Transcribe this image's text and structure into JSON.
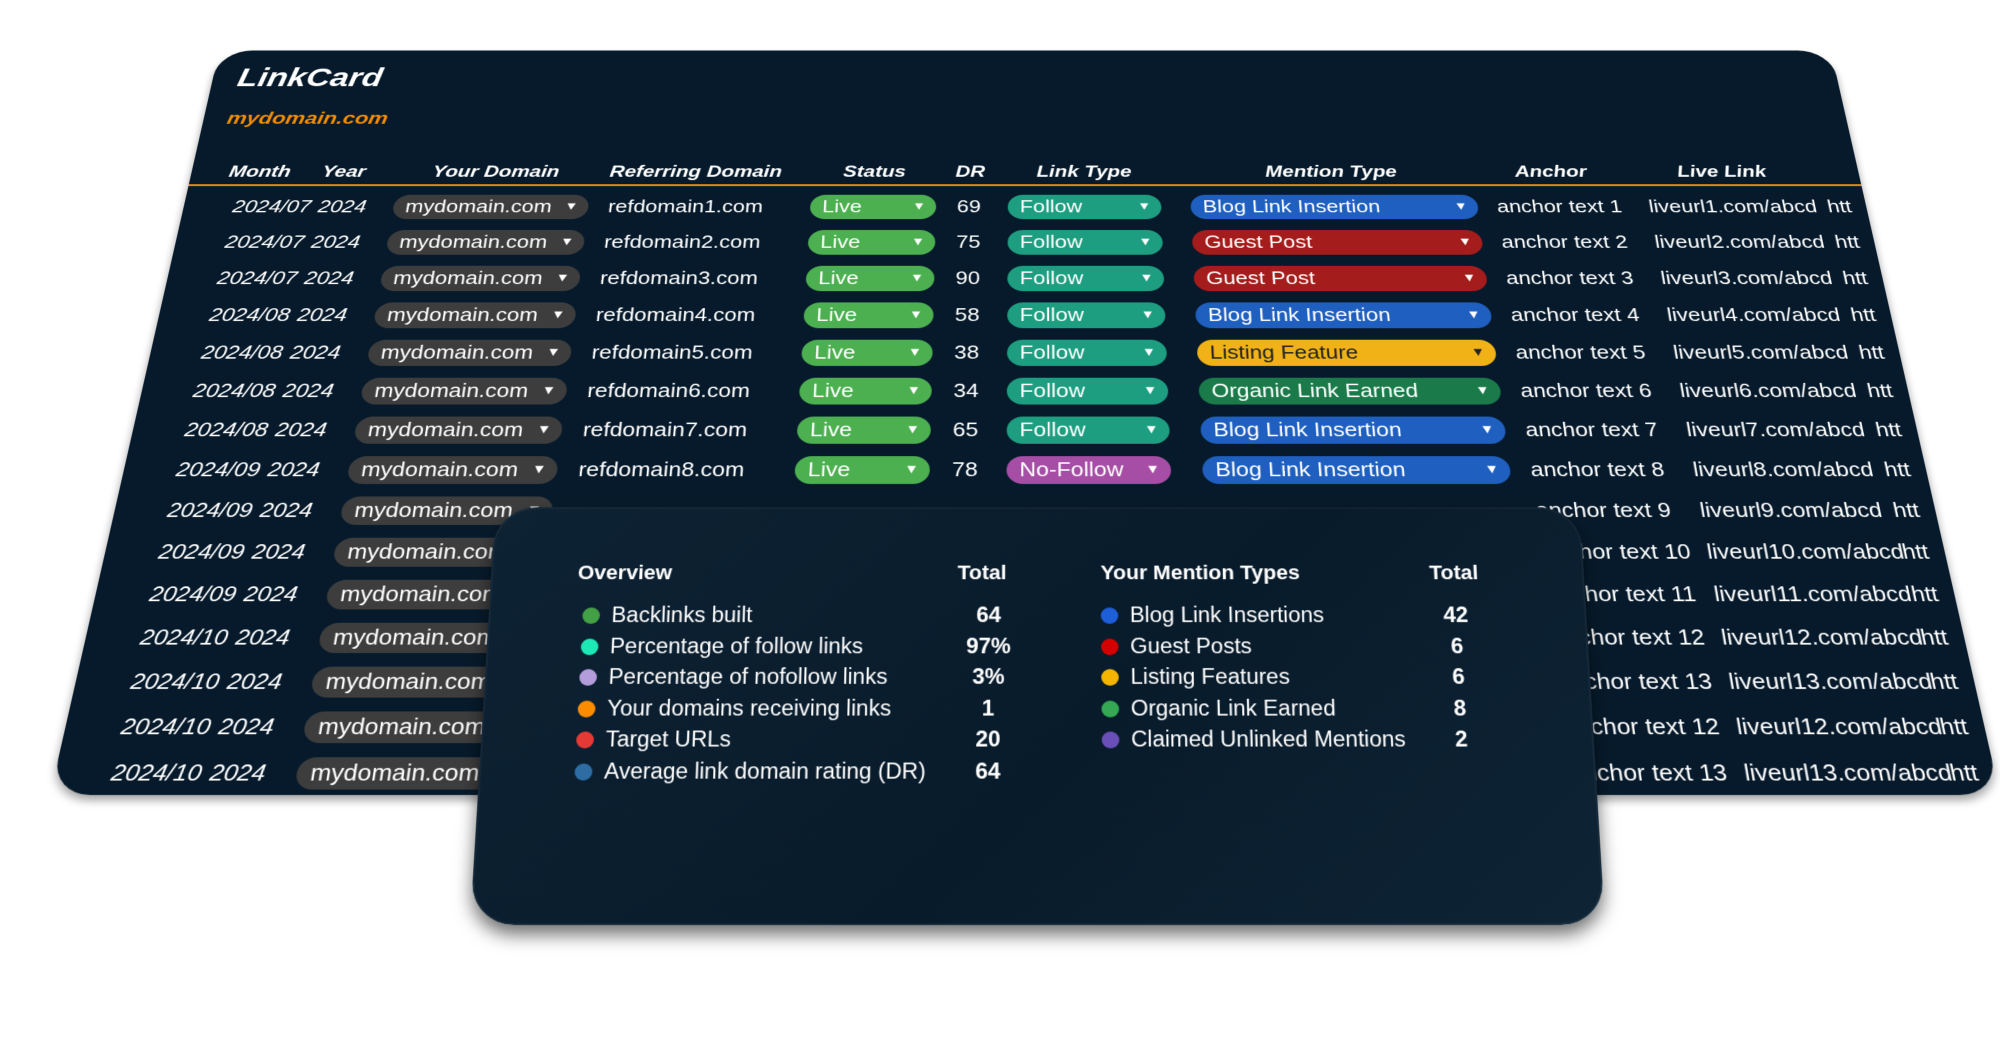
{
  "app": {
    "title": "LinkCard",
    "subtitle": "mydomain.com"
  },
  "columns": [
    "Month",
    "Year",
    "Your Domain",
    "Referring Domain",
    "Status",
    "DR",
    "Link Type",
    "Mention Type",
    "Anchor",
    "Live Link"
  ],
  "colors": {
    "background": "#061a2b",
    "accent": "#f08c00",
    "domain_pill": "#3d3d3d",
    "Live": "#4caf50",
    "Follow": "#1e9e80",
    "No-Follow": "#a64ea6",
    "Blog Link Insertion": "#1f5fbf",
    "Guest Post": "#a51c1c",
    "Listing Feature": "#f0b216",
    "Organic Link Earned": "#1b7a4a"
  },
  "rows": [
    {
      "month": "2024/07",
      "year": "2024",
      "domain": "mydomain.com",
      "ref": "refdomain1.com",
      "status": "Live",
      "dr": "69",
      "link_type": "Follow",
      "mention": "Blog Link Insertion",
      "anchor": "anchor text 1",
      "live": "liveurl1.com/abcd",
      "extra": "htt"
    },
    {
      "month": "2024/07",
      "year": "2024",
      "domain": "mydomain.com",
      "ref": "refdomain2.com",
      "status": "Live",
      "dr": "75",
      "link_type": "Follow",
      "mention": "Guest Post",
      "anchor": "anchor text 2",
      "live": "liveurl2.com/abcd",
      "extra": "htt"
    },
    {
      "month": "2024/07",
      "year": "2024",
      "domain": "mydomain.com",
      "ref": "refdomain3.com",
      "status": "Live",
      "dr": "90",
      "link_type": "Follow",
      "mention": "Guest Post",
      "anchor": "anchor text 3",
      "live": "liveurl3.com/abcd",
      "extra": "htt"
    },
    {
      "month": "2024/08",
      "year": "2024",
      "domain": "mydomain.com",
      "ref": "refdomain4.com",
      "status": "Live",
      "dr": "58",
      "link_type": "Follow",
      "mention": "Blog Link Insertion",
      "anchor": "anchor text 4",
      "live": "liveurl4.com/abcd",
      "extra": "htt"
    },
    {
      "month": "2024/08",
      "year": "2024",
      "domain": "mydomain.com",
      "ref": "refdomain5.com",
      "status": "Live",
      "dr": "38",
      "link_type": "Follow",
      "mention": "Listing Feature",
      "anchor": "anchor text 5",
      "live": "liveurl5.com/abcd",
      "extra": "htt"
    },
    {
      "month": "2024/08",
      "year": "2024",
      "domain": "mydomain.com",
      "ref": "refdomain6.com",
      "status": "Live",
      "dr": "34",
      "link_type": "Follow",
      "mention": "Organic Link Earned",
      "anchor": "anchor text 6",
      "live": "liveurl6.com/abcd",
      "extra": "htt"
    },
    {
      "month": "2024/08",
      "year": "2024",
      "domain": "mydomain.com",
      "ref": "refdomain7.com",
      "status": "Live",
      "dr": "65",
      "link_type": "Follow",
      "mention": "Blog Link Insertion",
      "anchor": "anchor text 7",
      "live": "liveurl7.com/abcd",
      "extra": "htt"
    },
    {
      "month": "2024/09",
      "year": "2024",
      "domain": "mydomain.com",
      "ref": "refdomain8.com",
      "status": "Live",
      "dr": "78",
      "link_type": "No-Follow",
      "mention": "Blog Link Insertion",
      "anchor": "anchor text 8",
      "live": "liveurl8.com/abcd",
      "extra": "htt"
    },
    {
      "month": "2024/09",
      "year": "2024",
      "domain": "mydomain.com",
      "anchor": "anchor text 9",
      "live": "liveurl9.com/abcd",
      "extra": "htt"
    },
    {
      "month": "2024/09",
      "year": "2024",
      "domain": "mydomain.com",
      "anchor": "anchor text 10",
      "live": "liveurl10.com/abcd",
      "extra": "htt"
    },
    {
      "month": "2024/09",
      "year": "2024",
      "domain": "mydomain.com",
      "anchor": "anchor text 11",
      "live": "liveurl11.com/abcd",
      "extra": "htt"
    },
    {
      "month": "2024/10",
      "year": "2024",
      "domain": "mydomain.com",
      "anchor": "anchor text 12",
      "live": "liveurl12.com/abcd",
      "extra": "htt"
    },
    {
      "month": "2024/10",
      "year": "2024",
      "domain": "mydomain.com",
      "anchor": "anchor text 13",
      "live": "liveurl13.com/abcd",
      "extra": "htt"
    },
    {
      "month": "2024/10",
      "year": "2024",
      "domain": "mydomain.com",
      "anchor": "anchor text 12",
      "live": "liveurl12.com/abcd",
      "extra": "htt"
    },
    {
      "month": "2024/10",
      "year": "2024",
      "domain": "mydomain.com",
      "anchor": "anchor text 13",
      "live": "liveurl13.com/abcd",
      "extra": "htt"
    }
  ],
  "overview": {
    "heading": "Overview",
    "total_label": "Total",
    "items": [
      {
        "label": "Backlinks built",
        "value": "64",
        "color": "#43a047"
      },
      {
        "label": "Percentage of follow links",
        "value": "97%",
        "color": "#1de9b6"
      },
      {
        "label": "Percentage of nofollow links",
        "value": "3%",
        "color": "#b39ddb"
      },
      {
        "label": "Your domains receiving links",
        "value": "1",
        "color": "#fb8c00"
      },
      {
        "label": "Target URLs",
        "value": "20",
        "color": "#e53935"
      },
      {
        "label": "Average link domain rating (DR)",
        "value": "64",
        "color": "#2e6da4"
      }
    ]
  },
  "mention_types": {
    "heading": "Your Mention Types",
    "total_label": "Total",
    "items": [
      {
        "label": "Blog Link Insertions",
        "value": "42",
        "color": "#1e5ed8"
      },
      {
        "label": "Guest Posts",
        "value": "6",
        "color": "#d50000"
      },
      {
        "label": "Listing Features",
        "value": "6",
        "color": "#f4b400"
      },
      {
        "label": "Organic Link Earned",
        "value": "8",
        "color": "#34a853"
      },
      {
        "label": "Claimed Unlinked Mentions",
        "value": "2",
        "color": "#6a4fb8"
      }
    ]
  }
}
